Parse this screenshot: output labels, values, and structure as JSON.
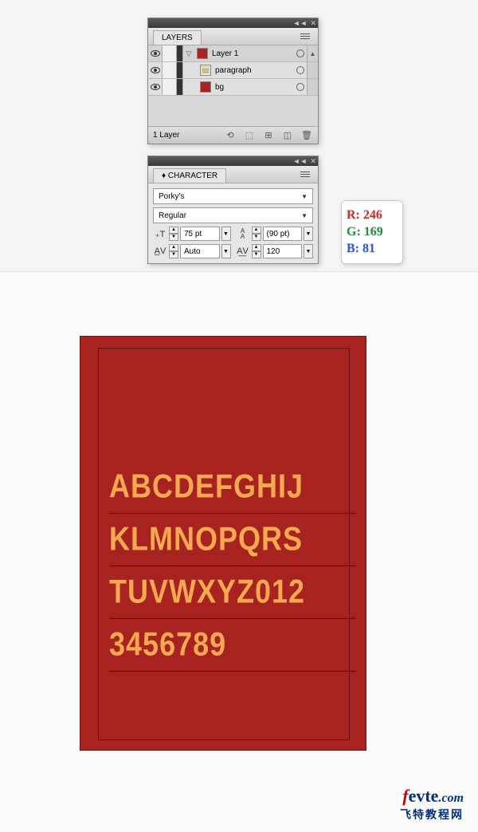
{
  "layers_panel": {
    "title": "LAYERS",
    "items": [
      {
        "name": "Layer 1",
        "swatch": "red",
        "expanded": true,
        "eye": true
      },
      {
        "name": "paragraph",
        "swatch": "doc",
        "eye": true,
        "indent": 1
      },
      {
        "name": "bg",
        "swatch": "red",
        "eye": true,
        "indent": 1
      }
    ],
    "footer_label": "1 Layer"
  },
  "character_panel": {
    "title": "CHARACTER",
    "font_family": "Porky's",
    "font_style": "Regular",
    "font_size": "75 pt",
    "leading": "(90 pt)",
    "kerning": "Auto",
    "tracking": "120"
  },
  "rgb": {
    "r_label": "R:",
    "r_val": "246",
    "g_label": "G:",
    "g_val": "169",
    "b_label": "B:",
    "b_val": "81"
  },
  "artwork": {
    "line1": "ABCDEFGHIJ",
    "line2": "KLMNOPQRS",
    "line3": "TUVWXYZ012",
    "line4": "3456789"
  },
  "watermark": {
    "top_f": "f",
    "top_evte": "evte",
    "top_com": ".com",
    "bottom": "飞特教程网"
  }
}
